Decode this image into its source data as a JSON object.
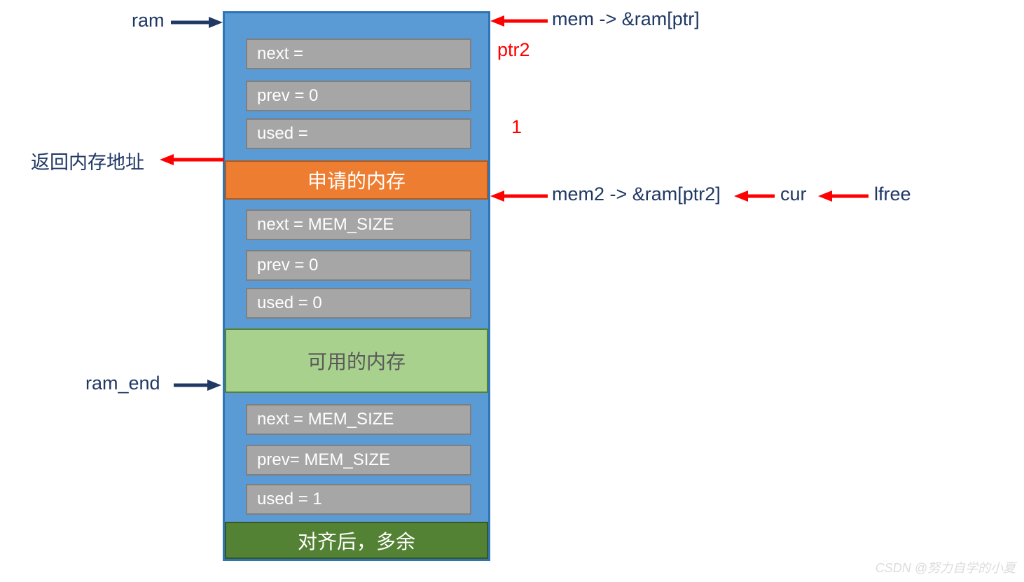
{
  "block1": {
    "next": "next =",
    "prev": "prev =   0",
    "used": "used =",
    "banner": "申请的内存"
  },
  "block2": {
    "next": "next =   MEM_SIZE",
    "prev": "prev =   0",
    "used": "used =   0",
    "banner": "可用的内存"
  },
  "block3": {
    "next": "next = MEM_SIZE",
    "prev": "prev= MEM_SIZE",
    "used": "used = 1",
    "banner": "对齐后，多余"
  },
  "labels": {
    "ram": "ram",
    "return_addr": "返回内存地址",
    "ram_end": "ram_end",
    "mem": "mem -> &ram[ptr]",
    "ptr2": "ptr2",
    "one": "1",
    "mem2": "mem2 -> &ram[ptr2]",
    "cur": "cur",
    "lfree": "lfree",
    "watermark": "CSDN @努力自学的小夏"
  },
  "colors": {
    "navy": "#1f3864",
    "red": "#ff0000"
  }
}
